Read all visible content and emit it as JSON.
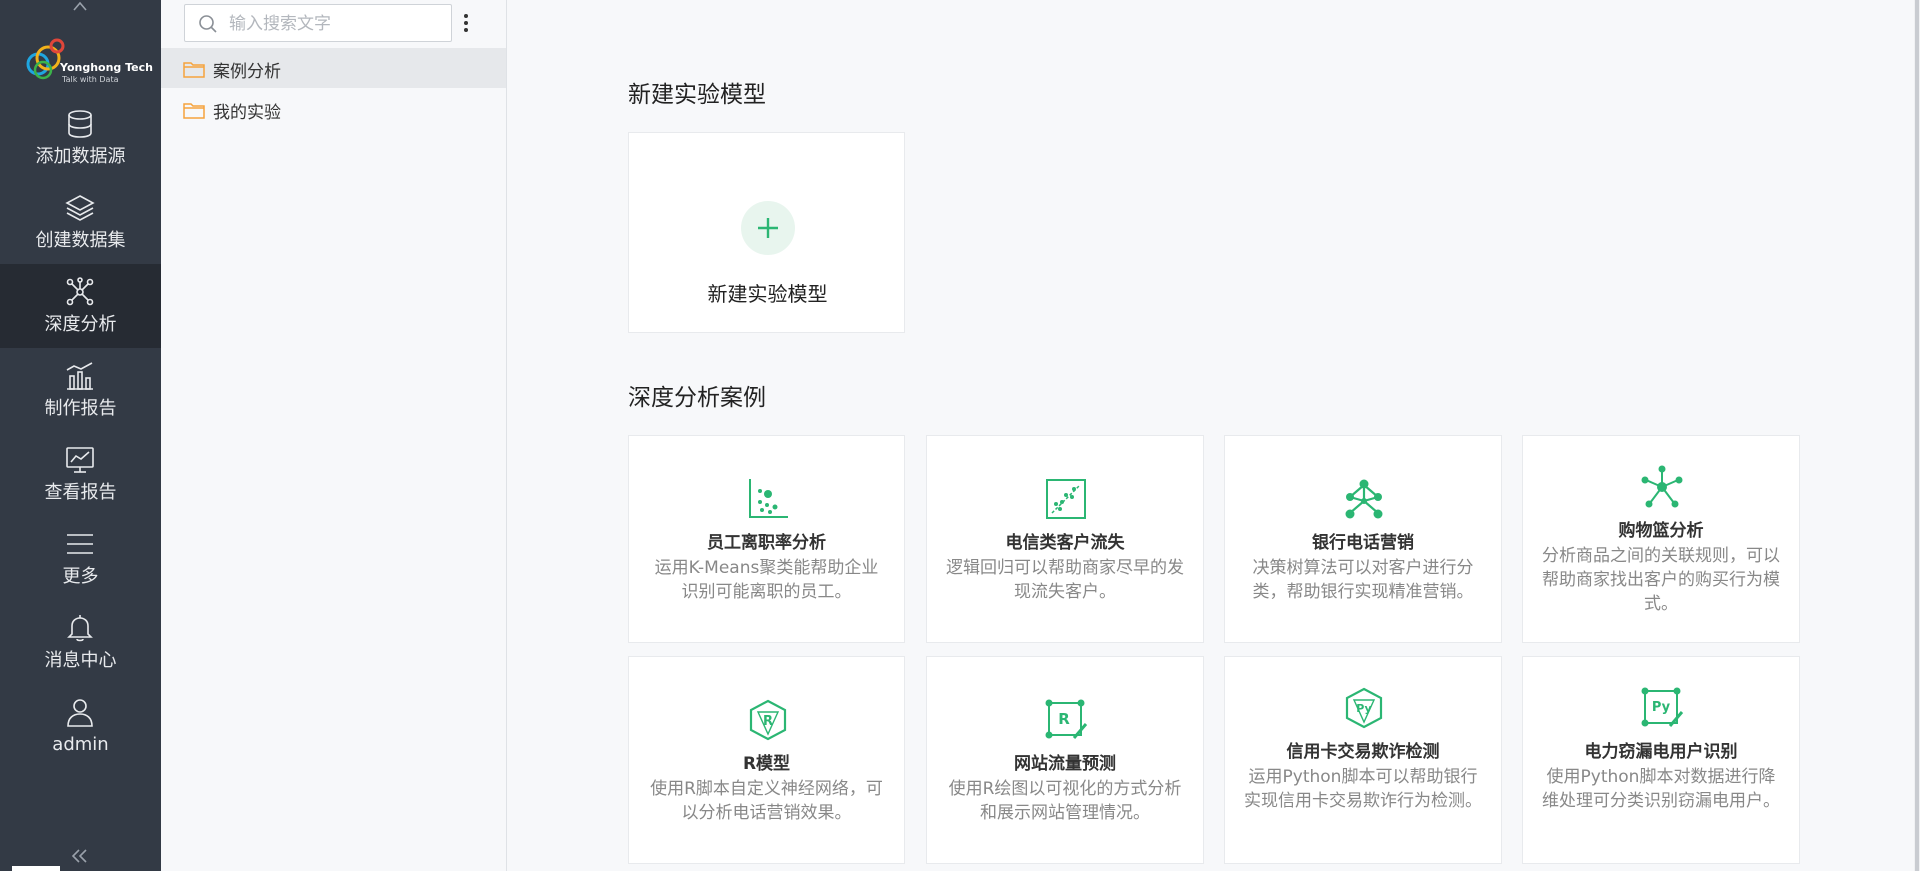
{
  "nav": {
    "logo_name": "Yonghong Tech",
    "logo_tagline": "Talk with Data",
    "items": [
      {
        "label": "添加数据源",
        "icon": "database-icon"
      },
      {
        "label": "创建数据集",
        "icon": "layers-icon"
      },
      {
        "label": "深度分析",
        "icon": "network-icon",
        "active": true
      },
      {
        "label": "制作报告",
        "icon": "bar-chart-icon"
      },
      {
        "label": "查看报告",
        "icon": "monitor-chart-icon"
      },
      {
        "label": "更多",
        "icon": "menu-icon"
      },
      {
        "label": "消息中心",
        "icon": "bell-icon"
      },
      {
        "label": "admin",
        "icon": "user-icon"
      }
    ]
  },
  "tree": {
    "search_placeholder": "输入搜索文字",
    "folders": [
      {
        "label": "案例分析",
        "selected": true
      },
      {
        "label": "我的实验",
        "selected": false
      }
    ]
  },
  "main": {
    "new_section_title": "新建实验模型",
    "new_card_label": "新建实验模型",
    "cases_section_title": "深度分析案例",
    "cases": [
      {
        "title": "员工离职率分析",
        "desc": "运用K-Means聚类能帮助企业识别可能离职的员工。",
        "icon": "scatter-plot-icon"
      },
      {
        "title": "电信类客户流失",
        "desc": "逻辑回归可以帮助商家尽早的发现流失客户。",
        "icon": "regression-icon"
      },
      {
        "title": "银行电话营销",
        "desc": "决策树算法可以对客户进行分类，帮助银行实现精准营销。",
        "icon": "decision-tree-icon"
      },
      {
        "title": "购物篮分析",
        "desc": "分析商品之间的关联规则，可以帮助商家找出客户的购买行为模式。",
        "icon": "association-icon"
      },
      {
        "title": "R模型",
        "desc": "使用R脚本自定义神经网络，可以分析电话营销效果。",
        "icon": "r-model-icon"
      },
      {
        "title": "网站流量预测",
        "desc": "使用R绘图以可视化的方式分析和展示网站管理情况。",
        "icon": "r-plot-icon"
      },
      {
        "title": "信用卡交易欺诈检测",
        "desc": "运用Python脚本可以帮助银行实现信用卡交易欺诈行为检测。",
        "icon": "python-icon"
      },
      {
        "title": "电力窃漏电用户识别",
        "desc": "使用Python脚本对数据进行降维处理可分类识别窃漏电用户。",
        "icon": "python-script-icon"
      }
    ]
  },
  "colors": {
    "nav_bg": "#333a45",
    "nav_active_bg": "#262b33",
    "accent_green": "#2bb673",
    "folder_orange": "#f5a33c"
  }
}
